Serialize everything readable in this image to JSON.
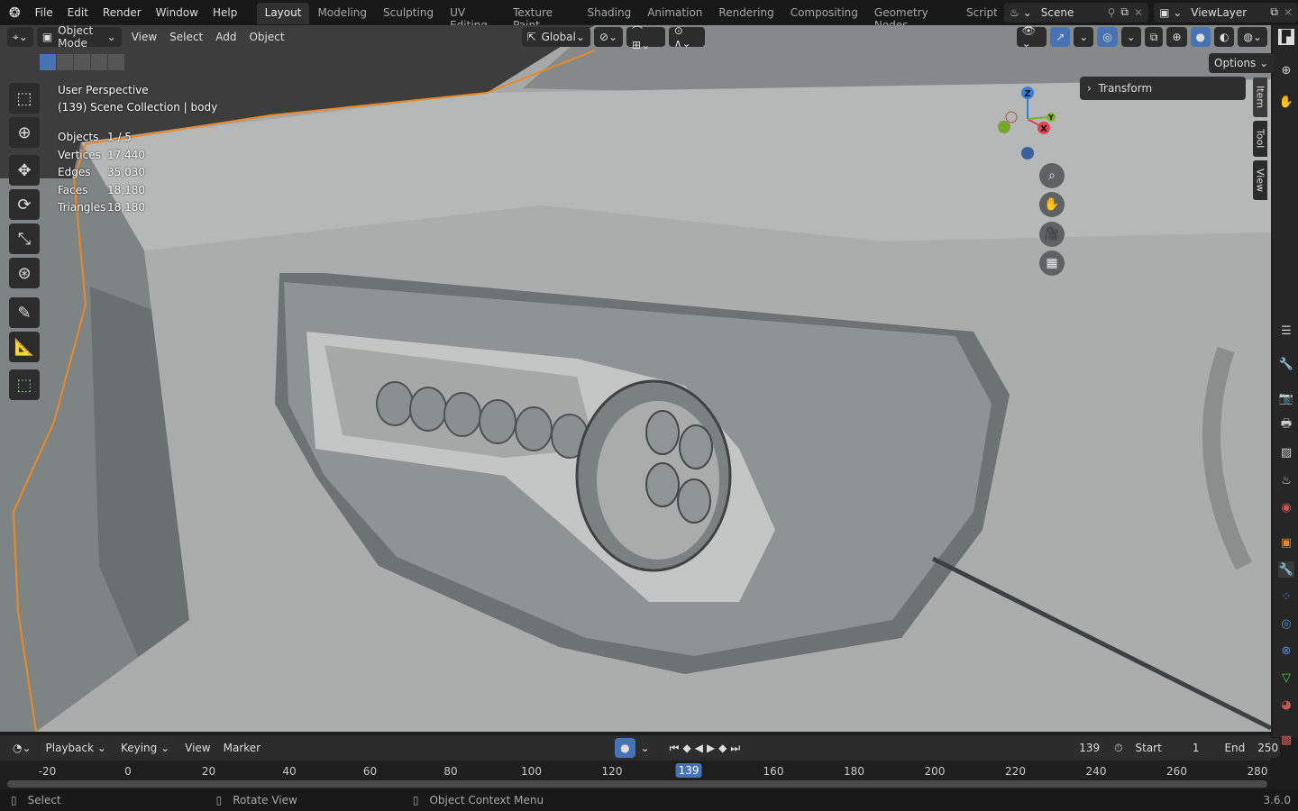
{
  "topbar": {
    "menus": [
      "File",
      "Edit",
      "Render",
      "Window",
      "Help"
    ],
    "workspaces": [
      "Layout",
      "Modeling",
      "Sculpting",
      "UV Editing",
      "Texture Paint",
      "Shading",
      "Animation",
      "Rendering",
      "Compositing",
      "Geometry Nodes",
      "Scripting"
    ],
    "active_workspace": "Layout",
    "scene": "Scene",
    "view_layer": "ViewLayer"
  },
  "viewport_header": {
    "mode": "Object Mode",
    "menus": [
      "View",
      "Select",
      "Add",
      "Object"
    ],
    "orientation": "Global",
    "options": "Options"
  },
  "overlay": {
    "view_name": "User Perspective",
    "collection": "(139) Scene Collection | body",
    "stats": [
      {
        "label": "Objects",
        "value": "1 / 5"
      },
      {
        "label": "Vertices",
        "value": "17,440"
      },
      {
        "label": "Edges",
        "value": "35,030"
      },
      {
        "label": "Faces",
        "value": "18,180"
      },
      {
        "label": "Triangles",
        "value": "18,180"
      }
    ]
  },
  "gizmo": {
    "x": "X",
    "y": "Y",
    "z": "Z"
  },
  "sidebar": {
    "panel": "Transform",
    "tabs": [
      "Item",
      "Tool",
      "View"
    ]
  },
  "timeline": {
    "menus": [
      "Playback",
      "Keying",
      "View",
      "Marker"
    ],
    "current_frame": "139",
    "start_label": "Start",
    "start": "1",
    "end_label": "End",
    "end": "250",
    "ticks": [
      "-20",
      "0",
      "20",
      "40",
      "60",
      "80",
      "100",
      "120",
      "139",
      "160",
      "180",
      "200",
      "220",
      "240",
      "260",
      "280"
    ]
  },
  "status": {
    "select": "Select",
    "rotate": "Rotate View",
    "context": "Object Context Menu",
    "version": "3.6.0"
  },
  "colors": {
    "accent": "#4772b3",
    "selection_outline": "#e8892a"
  }
}
